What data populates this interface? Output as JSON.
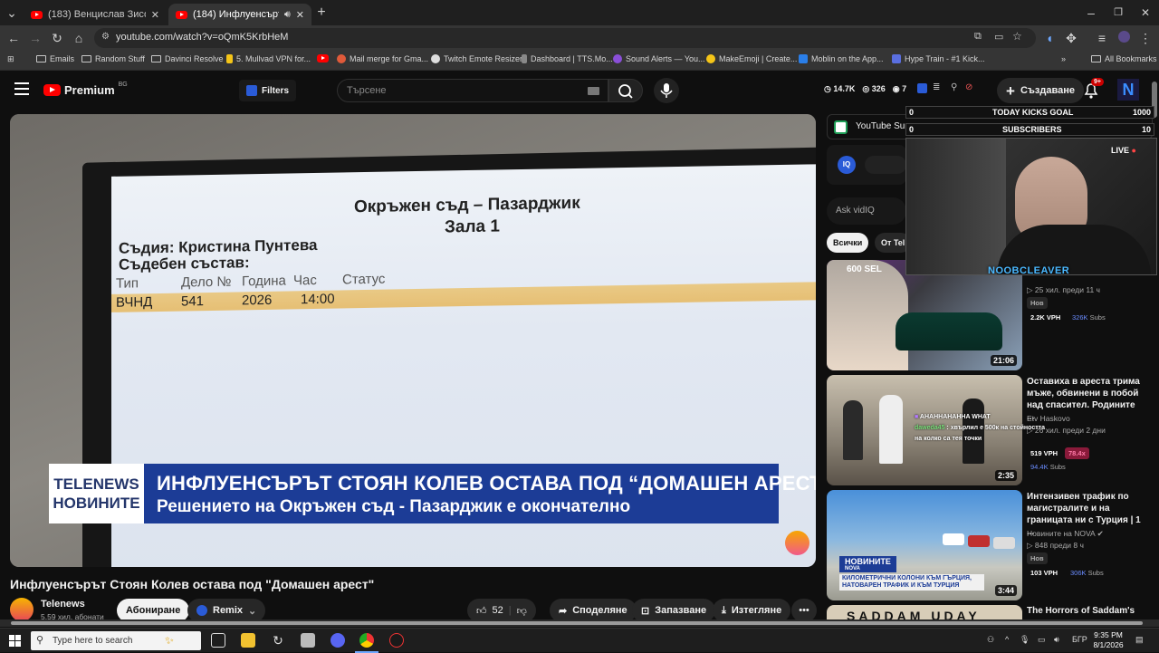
{
  "browser": {
    "tabs": [
      {
        "label": "(183) Венцислав Зисов - YouTube"
      },
      {
        "label": "(184) Инфлуенсърът Стоян"
      }
    ],
    "url": "youtube.com/watch?v=oQmK5KrbHeM",
    "bookmarks": [
      "Emails",
      "Random Stuff",
      "Davinci Resolve",
      "5. Mullvad VPN for...",
      "Mail merge for Gma...",
      "Twitch Emote Resizer",
      "Dashboard | TTS.Mo...",
      "Sound Alerts — You...",
      "MakeEmoji | Create...",
      "Moblin on the App...",
      "Hype Train - #1 Kick..."
    ],
    "all_bookmarks": "All Bookmarks"
  },
  "youtube": {
    "logo_text": "Premium",
    "logo_region": "BG",
    "filters_label": "Filters",
    "search_placeholder": "Търсене",
    "stats": {
      "views": "14.7K",
      "likes": "326",
      "watching": "7"
    },
    "create_label": "Създаване",
    "notif_count": "9+"
  },
  "video": {
    "screen": {
      "heading1": "Окръжен съд – Пазарджик",
      "heading2": "Зала 1",
      "judge": "Съдия: Кристина Пунтева",
      "panel": "Съдебен състав:",
      "cols": [
        "Тип",
        "Дело №",
        "Година",
        "Час",
        "Статус"
      ],
      "row": [
        "ВЧНД",
        "541",
        "2026",
        "14:00"
      ]
    },
    "chyron": {
      "brand1": "TELENEWS",
      "brand2": "НОВИНИТЕ",
      "title": "ИНФЛУЕНСЪРЪТ СТОЯН КОЛЕВ ОСТАВА ПОД “ДОМАШЕН АРЕСТ”",
      "subtitle": "Решението на Окръжен съд - Пазарджик е окончателно"
    }
  },
  "watch": {
    "title": "Инфлуенсърът Стоян Колев остава под \"Домашен арест\"",
    "channel": "Telenews",
    "subscribers": "5.59 хил. абонати",
    "subscribe_label": "Абониране",
    "remix_label": "Remix",
    "likes": "52",
    "share_label": "Споделяне",
    "save_label": "Запазване",
    "download_label": "Изтегляне"
  },
  "sidebar": {
    "summary_label": "YouTube Summary",
    "ask_placeholder": "Ask vidIQ",
    "chips": [
      "Всички",
      "От Tel"
    ],
    "items": [
      {
        "title": "",
        "meta1": "25 хил. преди 11 ч",
        "tag": "Нов",
        "vph": "2.2K VPH",
        "subs": "326K",
        "subs_label": "Subs",
        "duration": "21:06",
        "thumb_text": "600 SEL"
      },
      {
        "title": "Оставиха в ареста трима мъже, обвинени в побой над спасител. Родините ...",
        "channel": "Etv Haskovo",
        "meta1": "26 хил. преди 2 дни",
        "vph": "519 VPH",
        "ratio": "78.4x",
        "subs": "94.4K",
        "subs_label": "Subs",
        "duration": "2:35"
      },
      {
        "title": "Интензивен трафик по магистралите и на границата ни с Турция | 1 ...",
        "channel": "Новините на NOVA",
        "meta1": "848 преди 8 ч",
        "tag": "Нов",
        "vph": "103 VPH",
        "subs": "306K",
        "subs_label": "Subs",
        "duration": "3:44",
        "thumb_label": "НОВИНИТЕ",
        "thumb_sub": "NOVA",
        "thumb_caption": "КИЛОМЕТРИЧНИ КОЛОНИ КЪМ ГЪРЦИЯ, НАТОВАРЕН ТРАФИК И КЪМ ТУРЦИЯ"
      },
      {
        "title": "The Horrors of Saddam's",
        "thumb_text": "SADDAM UDAY"
      }
    ]
  },
  "stream_overlay": {
    "goal_left": "0",
    "goal_label": "TODAY KICKS GOAL",
    "goal_right": "1000",
    "subs_left": "0",
    "subs_label": "SUBSCRIBERS",
    "subs_right": "10",
    "live_label": "LIVE",
    "streamer_name": "NOOBCLEAVER",
    "chat": [
      {
        "user": "",
        "text": "AHAHHAHAHHA WHAT"
      },
      {
        "user": "daweda45",
        "text": "хвърлил е 500к на стойността"
      },
      {
        "user": "",
        "text": "на колко са тея точки"
      }
    ]
  },
  "taskbar": {
    "search_placeholder": "Type here to search",
    "time": "9:35 PM",
    "date": "8/1/2026",
    "lang": "БГР"
  }
}
